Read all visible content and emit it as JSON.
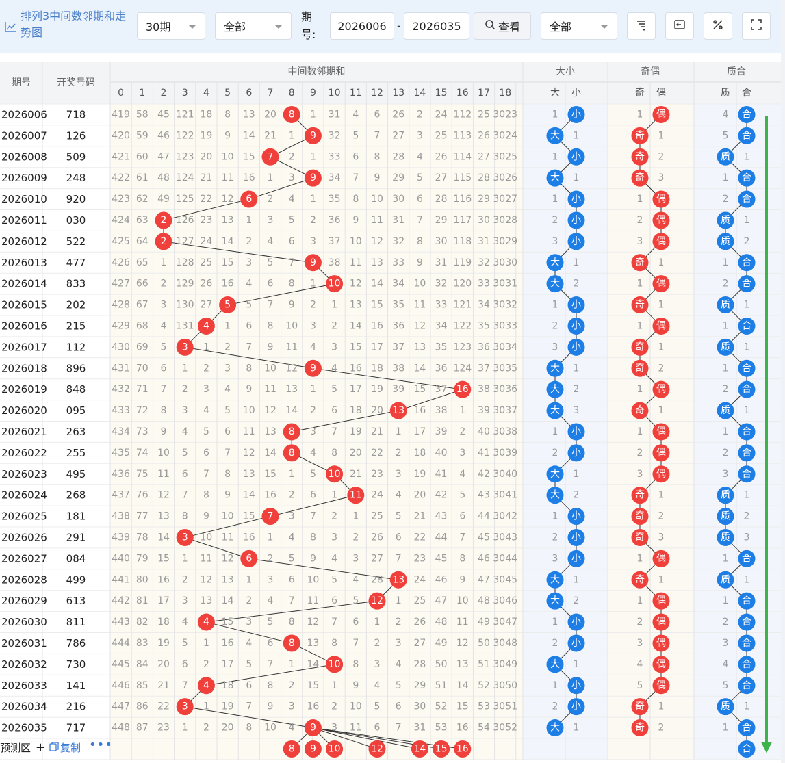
{
  "toolbar": {
    "title": "排列3中间数邻期和走势图",
    "period_count": "30期",
    "filter1": "全部",
    "period_label": "期号:",
    "start_period": "2026006",
    "end_period": "2026035",
    "query_label": "查看",
    "filter2": "全部"
  },
  "icons": {
    "title": "line-chart-icon",
    "query": "search-icon",
    "sort": "sort-icon",
    "export": "export-icon",
    "tools": "tools-icon",
    "fullscreen": "fullscreen-icon",
    "add": "plus-icon",
    "copy": "copy-icon",
    "more": "more-icon"
  },
  "colors": {
    "red_ball": "#f0403c",
    "blue_ball": "#1d7ee6",
    "trend_arrow": "#3db34a",
    "link": "#3a7bd5"
  },
  "headers": {
    "period": "期号",
    "draw": "开奖号码",
    "sum_group": "中间数邻期和",
    "size_group": "大小",
    "size_cols": [
      "大",
      "小"
    ],
    "parity_group": "奇偶",
    "parity_cols": [
      "奇",
      "偶"
    ],
    "prime_group": "质合",
    "prime_cols": [
      "质",
      "合"
    ],
    "sum_cols": [
      "0",
      "1",
      "2",
      "3",
      "4",
      "5",
      "6",
      "7",
      "8",
      "9",
      "10",
      "11",
      "12",
      "13",
      "14",
      "15",
      "16",
      "17",
      "18"
    ]
  },
  "rows": [
    {
      "period": "2026006",
      "draw": "718",
      "hit": 8,
      "cells": [
        "419",
        "58",
        "45",
        "121",
        "18",
        "8",
        "13",
        "20",
        "8",
        "1",
        "31",
        "4",
        "6",
        "26",
        "2",
        "24",
        "112",
        "25",
        "3023"
      ],
      "size": [
        "1",
        "小"
      ],
      "parity": [
        "1",
        "偶"
      ],
      "prime": [
        "4",
        "合"
      ]
    },
    {
      "period": "2026007",
      "draw": "126",
      "hit": 9,
      "cells": [
        "420",
        "59",
        "46",
        "122",
        "19",
        "9",
        "14",
        "21",
        "1",
        "9",
        "32",
        "5",
        "7",
        "27",
        "3",
        "25",
        "113",
        "26",
        "3024"
      ],
      "size": [
        "大",
        "1"
      ],
      "parity": [
        "奇",
        "1"
      ],
      "prime": [
        "5",
        "合"
      ]
    },
    {
      "period": "2026008",
      "draw": "509",
      "hit": 7,
      "cells": [
        "421",
        "60",
        "47",
        "123",
        "20",
        "10",
        "15",
        "7",
        "2",
        "1",
        "33",
        "6",
        "8",
        "28",
        "4",
        "26",
        "114",
        "27",
        "3025"
      ],
      "size": [
        "1",
        "小"
      ],
      "parity": [
        "奇",
        "2"
      ],
      "prime": [
        "质",
        "1"
      ]
    },
    {
      "period": "2026009",
      "draw": "248",
      "hit": 9,
      "cells": [
        "422",
        "61",
        "48",
        "124",
        "21",
        "11",
        "16",
        "1",
        "3",
        "9",
        "34",
        "7",
        "9",
        "29",
        "5",
        "27",
        "115",
        "28",
        "3026"
      ],
      "size": [
        "大",
        "1"
      ],
      "parity": [
        "奇",
        "3"
      ],
      "prime": [
        "1",
        "合"
      ]
    },
    {
      "period": "2026010",
      "draw": "920",
      "hit": 6,
      "cells": [
        "423",
        "62",
        "49",
        "125",
        "22",
        "12",
        "6",
        "2",
        "4",
        "1",
        "35",
        "8",
        "10",
        "30",
        "6",
        "28",
        "116",
        "29",
        "3027"
      ],
      "size": [
        "1",
        "小"
      ],
      "parity": [
        "1",
        "偶"
      ],
      "prime": [
        "2",
        "合"
      ]
    },
    {
      "period": "2026011",
      "draw": "030",
      "hit": 2,
      "cells": [
        "424",
        "63",
        "2",
        "126",
        "23",
        "13",
        "1",
        "3",
        "5",
        "2",
        "36",
        "9",
        "11",
        "31",
        "7",
        "29",
        "117",
        "30",
        "3028"
      ],
      "size": [
        "2",
        "小"
      ],
      "parity": [
        "2",
        "偶"
      ],
      "prime": [
        "质",
        "1"
      ]
    },
    {
      "period": "2026012",
      "draw": "522",
      "hit": 2,
      "cells": [
        "425",
        "64",
        "2",
        "127",
        "24",
        "14",
        "2",
        "4",
        "6",
        "3",
        "37",
        "10",
        "12",
        "32",
        "8",
        "30",
        "118",
        "31",
        "3029"
      ],
      "size": [
        "3",
        "小"
      ],
      "parity": [
        "3",
        "偶"
      ],
      "prime": [
        "质",
        "2"
      ]
    },
    {
      "period": "2026013",
      "draw": "477",
      "hit": 9,
      "cells": [
        "426",
        "65",
        "1",
        "128",
        "25",
        "15",
        "3",
        "5",
        "7",
        "9",
        "38",
        "11",
        "13",
        "33",
        "9",
        "31",
        "119",
        "32",
        "3030"
      ],
      "size": [
        "大",
        "1"
      ],
      "parity": [
        "奇",
        "1"
      ],
      "prime": [
        "1",
        "合"
      ]
    },
    {
      "period": "2026014",
      "draw": "833",
      "hit": 10,
      "cells": [
        "427",
        "66",
        "2",
        "129",
        "26",
        "16",
        "4",
        "6",
        "8",
        "1",
        "10",
        "12",
        "14",
        "34",
        "10",
        "32",
        "120",
        "33",
        "3031"
      ],
      "size": [
        "大",
        "2"
      ],
      "parity": [
        "1",
        "偶"
      ],
      "prime": [
        "2",
        "合"
      ]
    },
    {
      "period": "2026015",
      "draw": "202",
      "hit": 5,
      "cells": [
        "428",
        "67",
        "3",
        "130",
        "27",
        "5",
        "5",
        "7",
        "9",
        "2",
        "1",
        "13",
        "15",
        "35",
        "11",
        "33",
        "121",
        "34",
        "3032"
      ],
      "size": [
        "1",
        "小"
      ],
      "parity": [
        "奇",
        "1"
      ],
      "prime": [
        "质",
        "1"
      ]
    },
    {
      "period": "2026016",
      "draw": "215",
      "hit": 4,
      "cells": [
        "429",
        "68",
        "4",
        "131",
        "4",
        "1",
        "6",
        "8",
        "10",
        "3",
        "2",
        "14",
        "16",
        "36",
        "12",
        "34",
        "122",
        "35",
        "3033"
      ],
      "size": [
        "2",
        "小"
      ],
      "parity": [
        "1",
        "偶"
      ],
      "prime": [
        "1",
        "合"
      ]
    },
    {
      "period": "2026017",
      "draw": "112",
      "hit": 3,
      "cells": [
        "430",
        "69",
        "5",
        "3",
        "1",
        "2",
        "7",
        "9",
        "11",
        "4",
        "3",
        "15",
        "17",
        "37",
        "13",
        "35",
        "123",
        "36",
        "3034"
      ],
      "size": [
        "3",
        "小"
      ],
      "parity": [
        "奇",
        "1"
      ],
      "prime": [
        "质",
        "1"
      ]
    },
    {
      "period": "2026018",
      "draw": "896",
      "hit": 9,
      "cells": [
        "431",
        "70",
        "6",
        "1",
        "2",
        "3",
        "8",
        "10",
        "12",
        "9",
        "4",
        "16",
        "18",
        "38",
        "14",
        "36",
        "124",
        "37",
        "3035"
      ],
      "size": [
        "大",
        "1"
      ],
      "parity": [
        "奇",
        "2"
      ],
      "prime": [
        "1",
        "合"
      ]
    },
    {
      "period": "2026019",
      "draw": "848",
      "hit": 16,
      "cells": [
        "432",
        "71",
        "7",
        "2",
        "3",
        "4",
        "9",
        "11",
        "13",
        "1",
        "5",
        "17",
        "19",
        "39",
        "15",
        "37",
        "16",
        "38",
        "3036"
      ],
      "size": [
        "大",
        "2"
      ],
      "parity": [
        "1",
        "偶"
      ],
      "prime": [
        "2",
        "合"
      ]
    },
    {
      "period": "2026020",
      "draw": "095",
      "hit": 13,
      "cells": [
        "433",
        "72",
        "8",
        "3",
        "4",
        "5",
        "10",
        "12",
        "14",
        "2",
        "6",
        "18",
        "20",
        "13",
        "16",
        "38",
        "1",
        "39",
        "3037"
      ],
      "size": [
        "大",
        "3"
      ],
      "parity": [
        "奇",
        "1"
      ],
      "prime": [
        "质",
        "1"
      ]
    },
    {
      "period": "2026021",
      "draw": "263",
      "hit": 8,
      "cells": [
        "434",
        "73",
        "9",
        "4",
        "5",
        "6",
        "11",
        "13",
        "8",
        "3",
        "7",
        "19",
        "21",
        "1",
        "17",
        "39",
        "2",
        "40",
        "3038"
      ],
      "size": [
        "1",
        "小"
      ],
      "parity": [
        "1",
        "偶"
      ],
      "prime": [
        "1",
        "合"
      ]
    },
    {
      "period": "2026022",
      "draw": "255",
      "hit": 8,
      "cells": [
        "435",
        "74",
        "10",
        "5",
        "6",
        "7",
        "12",
        "14",
        "8",
        "4",
        "8",
        "20",
        "22",
        "2",
        "18",
        "40",
        "3",
        "41",
        "3039"
      ],
      "size": [
        "2",
        "小"
      ],
      "parity": [
        "2",
        "偶"
      ],
      "prime": [
        "2",
        "合"
      ]
    },
    {
      "period": "2026023",
      "draw": "495",
      "hit": 10,
      "cells": [
        "436",
        "75",
        "11",
        "6",
        "7",
        "8",
        "13",
        "15",
        "1",
        "5",
        "10",
        "21",
        "23",
        "3",
        "19",
        "41",
        "4",
        "42",
        "3040"
      ],
      "size": [
        "大",
        "1"
      ],
      "parity": [
        "3",
        "偶"
      ],
      "prime": [
        "3",
        "合"
      ]
    },
    {
      "period": "2026024",
      "draw": "268",
      "hit": 11,
      "cells": [
        "437",
        "76",
        "12",
        "7",
        "8",
        "9",
        "14",
        "16",
        "2",
        "6",
        "1",
        "11",
        "24",
        "4",
        "20",
        "42",
        "5",
        "43",
        "3041"
      ],
      "size": [
        "大",
        "2"
      ],
      "parity": [
        "奇",
        "1"
      ],
      "prime": [
        "质",
        "1"
      ]
    },
    {
      "period": "2026025",
      "draw": "181",
      "hit": 7,
      "cells": [
        "438",
        "77",
        "13",
        "8",
        "9",
        "10",
        "15",
        "7",
        "3",
        "7",
        "2",
        "1",
        "25",
        "5",
        "21",
        "43",
        "6",
        "44",
        "3042"
      ],
      "size": [
        "1",
        "小"
      ],
      "parity": [
        "奇",
        "2"
      ],
      "prime": [
        "质",
        "2"
      ]
    },
    {
      "period": "2026026",
      "draw": "291",
      "hit": 3,
      "cells": [
        "439",
        "78",
        "14",
        "3",
        "10",
        "11",
        "16",
        "1",
        "4",
        "8",
        "3",
        "2",
        "26",
        "6",
        "22",
        "44",
        "7",
        "45",
        "3043"
      ],
      "size": [
        "2",
        "小"
      ],
      "parity": [
        "奇",
        "3"
      ],
      "prime": [
        "质",
        "3"
      ]
    },
    {
      "period": "2026027",
      "draw": "084",
      "hit": 6,
      "cells": [
        "440",
        "79",
        "15",
        "1",
        "11",
        "12",
        "6",
        "2",
        "5",
        "9",
        "4",
        "3",
        "27",
        "7",
        "23",
        "45",
        "8",
        "46",
        "3044"
      ],
      "size": [
        "3",
        "小"
      ],
      "parity": [
        "1",
        "偶"
      ],
      "prime": [
        "1",
        "合"
      ]
    },
    {
      "period": "2026028",
      "draw": "499",
      "hit": 13,
      "cells": [
        "441",
        "80",
        "16",
        "2",
        "12",
        "13",
        "1",
        "3",
        "6",
        "10",
        "5",
        "4",
        "28",
        "13",
        "24",
        "46",
        "9",
        "47",
        "3045"
      ],
      "size": [
        "大",
        "1"
      ],
      "parity": [
        "奇",
        "1"
      ],
      "prime": [
        "质",
        "1"
      ]
    },
    {
      "period": "2026029",
      "draw": "613",
      "hit": 12,
      "cells": [
        "442",
        "81",
        "17",
        "3",
        "13",
        "14",
        "2",
        "4",
        "7",
        "11",
        "6",
        "5",
        "12",
        "1",
        "25",
        "47",
        "10",
        "48",
        "3046"
      ],
      "size": [
        "大",
        "2"
      ],
      "parity": [
        "1",
        "偶"
      ],
      "prime": [
        "1",
        "合"
      ]
    },
    {
      "period": "2026030",
      "draw": "811",
      "hit": 4,
      "cells": [
        "443",
        "82",
        "18",
        "4",
        "4",
        "15",
        "3",
        "5",
        "8",
        "12",
        "7",
        "6",
        "1",
        "2",
        "26",
        "48",
        "11",
        "49",
        "3047"
      ],
      "size": [
        "1",
        "小"
      ],
      "parity": [
        "2",
        "偶"
      ],
      "prime": [
        "2",
        "合"
      ]
    },
    {
      "period": "2026031",
      "draw": "786",
      "hit": 8,
      "cells": [
        "444",
        "83",
        "19",
        "5",
        "1",
        "16",
        "4",
        "6",
        "8",
        "13",
        "8",
        "7",
        "2",
        "3",
        "27",
        "49",
        "12",
        "50",
        "3048"
      ],
      "size": [
        "2",
        "小"
      ],
      "parity": [
        "3",
        "偶"
      ],
      "prime": [
        "3",
        "合"
      ]
    },
    {
      "period": "2026032",
      "draw": "730",
      "hit": 10,
      "cells": [
        "445",
        "84",
        "20",
        "6",
        "2",
        "17",
        "5",
        "7",
        "1",
        "14",
        "10",
        "8",
        "3",
        "4",
        "28",
        "50",
        "13",
        "51",
        "3049"
      ],
      "size": [
        "大",
        "1"
      ],
      "parity": [
        "4",
        "偶"
      ],
      "prime": [
        "4",
        "合"
      ]
    },
    {
      "period": "2026033",
      "draw": "141",
      "hit": 4,
      "cells": [
        "446",
        "85",
        "21",
        "7",
        "4",
        "18",
        "6",
        "8",
        "2",
        "15",
        "1",
        "9",
        "4",
        "5",
        "29",
        "51",
        "14",
        "52",
        "3050"
      ],
      "size": [
        "1",
        "小"
      ],
      "parity": [
        "5",
        "偶"
      ],
      "prime": [
        "5",
        "合"
      ]
    },
    {
      "period": "2026034",
      "draw": "216",
      "hit": 3,
      "cells": [
        "447",
        "86",
        "22",
        "3",
        "1",
        "19",
        "7",
        "9",
        "3",
        "16",
        "2",
        "10",
        "5",
        "6",
        "30",
        "52",
        "15",
        "53",
        "3051"
      ],
      "size": [
        "2",
        "小"
      ],
      "parity": [
        "奇",
        "1"
      ],
      "prime": [
        "质",
        "1"
      ]
    },
    {
      "period": "2026035",
      "draw": "717",
      "hit": 9,
      "cells": [
        "448",
        "87",
        "23",
        "1",
        "2",
        "20",
        "8",
        "10",
        "4",
        "9",
        "3",
        "11",
        "6",
        "7",
        "31",
        "53",
        "16",
        "54",
        "3052"
      ],
      "size": [
        "大",
        "1"
      ],
      "parity": [
        "奇",
        "2"
      ],
      "prime": [
        "1",
        "合"
      ]
    }
  ],
  "prediction": {
    "label": "预测区",
    "copy_label": "复制",
    "more": "•••",
    "balls": [
      "8",
      "9",
      "10",
      "12",
      "14",
      "15",
      "16"
    ],
    "prime_ball": "合"
  }
}
